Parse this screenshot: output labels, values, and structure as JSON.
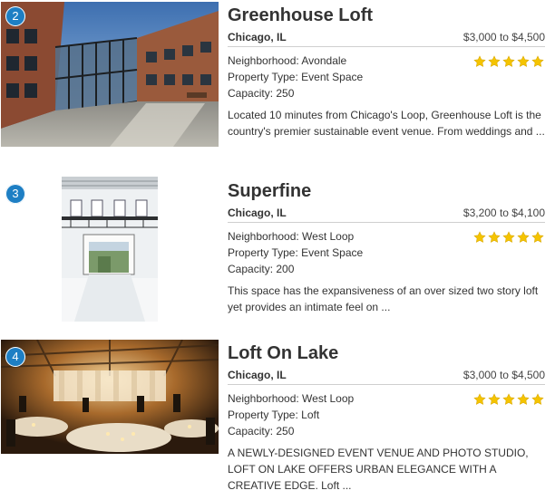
{
  "accent": {
    "badge": "#1e7fc4",
    "star": "#f5c400"
  },
  "listings": [
    {
      "rank": "2",
      "name": "Greenhouse Loft",
      "city": "Chicago, IL",
      "price": "$3,000 to $4,500",
      "neighborhood": "Neighborhood: Avondale",
      "property_type": "Property Type: Event Space",
      "capacity": "Capacity: 250",
      "rating": 5,
      "description": "Located 10 minutes from Chicago's Loop, Greenhouse Loft is the country's premier sustainable event venue. From weddings and ...",
      "image_icon": "building-photo-icon"
    },
    {
      "rank": "3",
      "name": "Superfine",
      "city": "Chicago, IL",
      "price": "$3,200 to $4,100",
      "neighborhood": "Neighborhood: West Loop",
      "property_type": "Property Type: Event Space",
      "capacity": "Capacity: 200",
      "rating": 5,
      "description": "This space has the expansiveness of an over sized two story loft yet provides an intimate feel on ...",
      "image_icon": "interior-photo-icon"
    },
    {
      "rank": "4",
      "name": "Loft On Lake",
      "city": "Chicago, IL",
      "price": "$3,000 to $4,500",
      "neighborhood": "Neighborhood: West Loop",
      "property_type": "Property Type: Loft",
      "capacity": "Capacity: 250",
      "rating": 5,
      "description": "A NEWLY-DESIGNED EVENT VENUE AND PHOTO STUDIO, LOFT ON LAKE OFFERS URBAN ELEGANCE WITH A CREATIVE EDGE. Loft ...",
      "image_icon": "banquet-photo-icon"
    }
  ]
}
